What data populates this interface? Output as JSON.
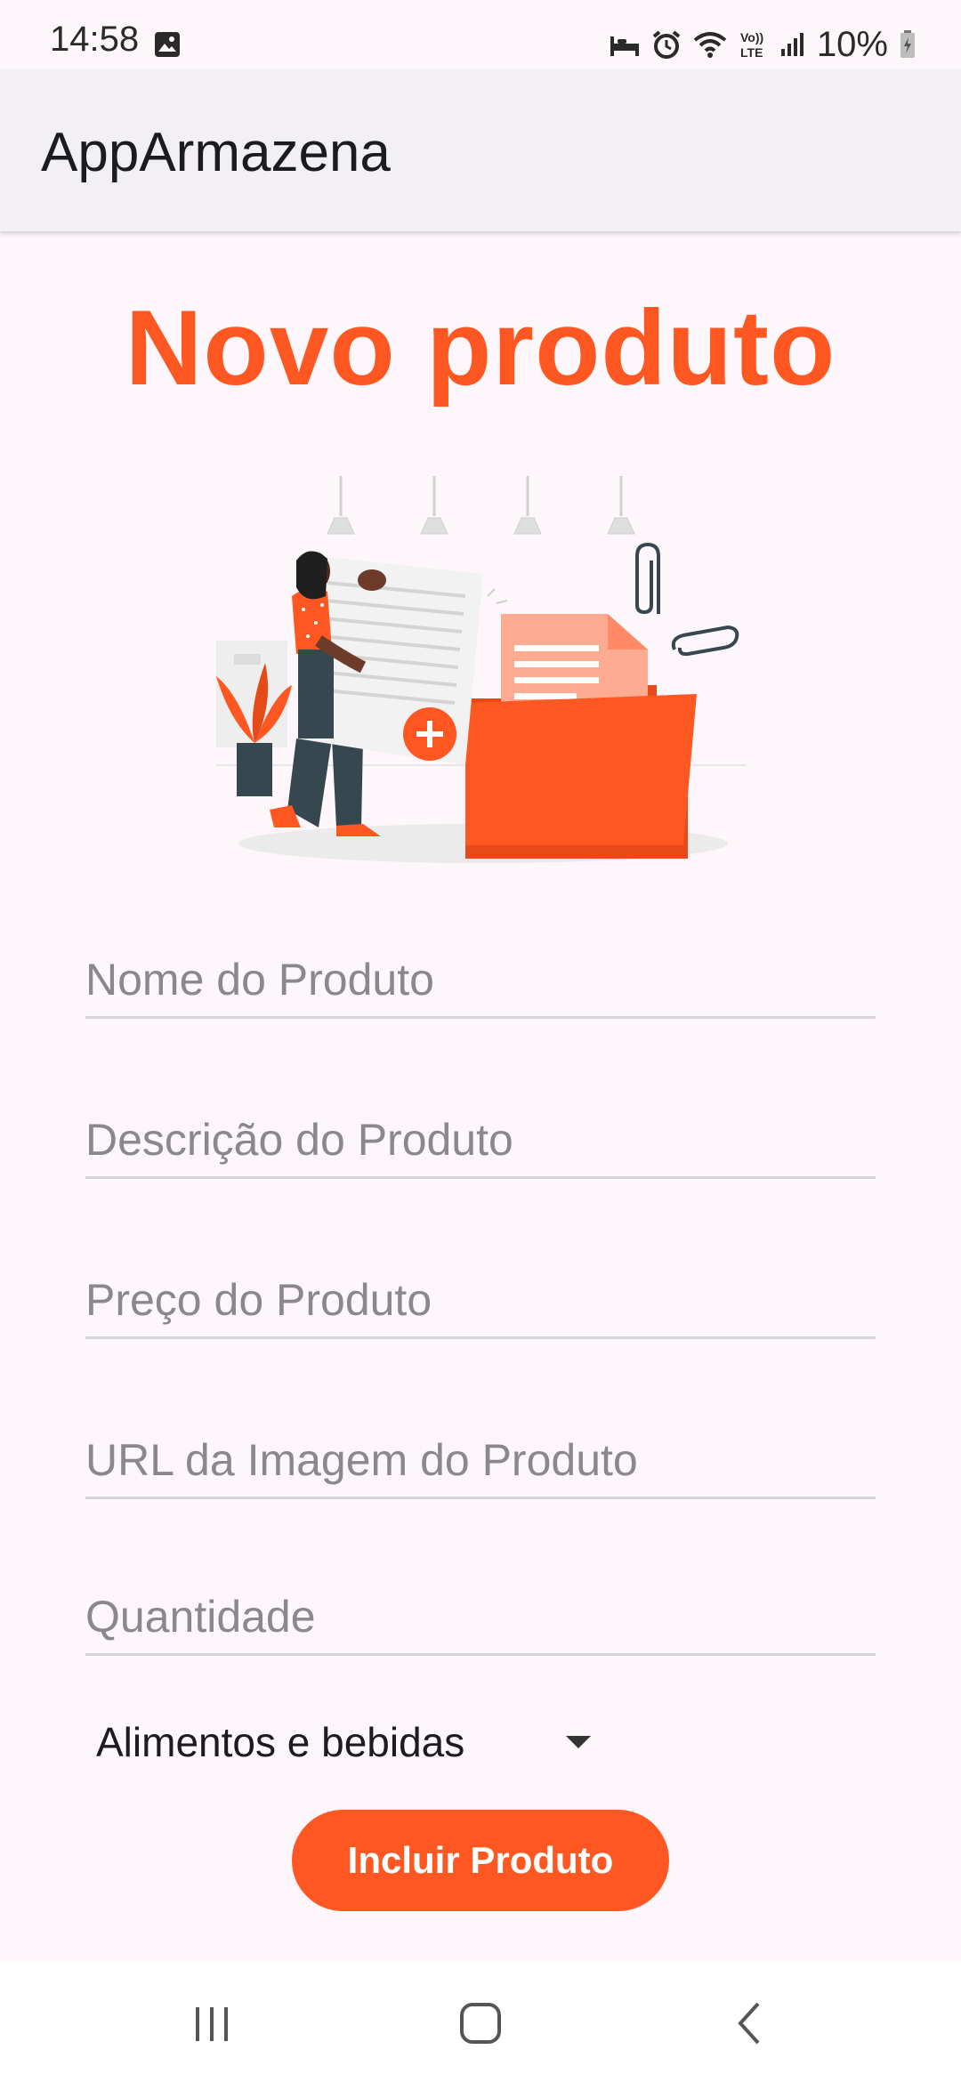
{
  "status_bar": {
    "time": "14:58",
    "battery_percent": "10%",
    "icons": [
      "gallery-icon",
      "sleep-icon",
      "alarm-icon",
      "wifi-icon",
      "volte-icon",
      "signal-icon",
      "battery-charging-icon"
    ]
  },
  "app_bar": {
    "title": "AppArmazena"
  },
  "page": {
    "title": "Novo produto"
  },
  "form": {
    "name_placeholder": "Nome do Produto",
    "description_placeholder": "Descrição do Produto",
    "price_placeholder": "Preço do Produto",
    "image_url_placeholder": "URL da Imagem do Produto",
    "quantity_placeholder": "Quantidade",
    "category_selected": "Alimentos e bebidas",
    "submit_label": "Incluir Produto"
  },
  "colors": {
    "accent": "#ff5722",
    "background": "#fdf7fb",
    "app_bar": "#f2eff5"
  },
  "nav_bar": {
    "icons": [
      "recent-apps-icon",
      "home-icon",
      "back-icon"
    ]
  }
}
